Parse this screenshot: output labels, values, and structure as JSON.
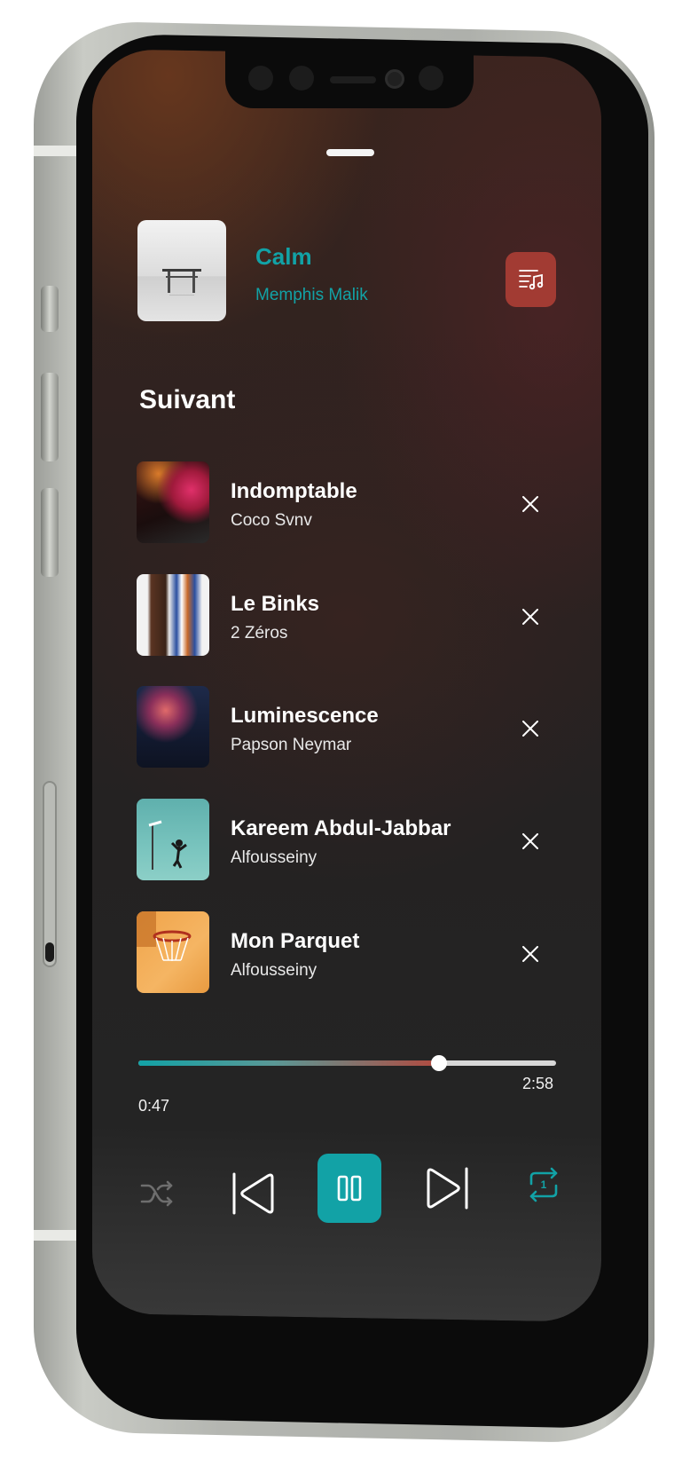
{
  "now_playing": {
    "title": "Calm",
    "artist": "Memphis Malik",
    "lyrics_icon": "music-list-icon"
  },
  "queue": {
    "heading": "Suivant",
    "items": [
      {
        "title": "Indomptable",
        "artist": "Coco Svnv"
      },
      {
        "title": "Le Binks",
        "artist": "2 Zéros"
      },
      {
        "title": "Luminescence",
        "artist": "Papson Neymar"
      },
      {
        "title": "Kareem Abdul-Jabbar",
        "artist": "Alfousseiny"
      },
      {
        "title": "Mon Parquet",
        "artist": "Alfousseiny"
      }
    ],
    "remove_icon": "close-icon"
  },
  "player": {
    "current_time": "0:47",
    "total_time": "2:58",
    "progress": 0.72,
    "controls": {
      "shuffle": "shuffle-icon",
      "previous": "skip-previous-icon",
      "play_pause": "pause-icon",
      "next": "skip-next-icon",
      "repeat": "repeat-one-icon"
    }
  },
  "colors": {
    "accent": "#12a2a6",
    "lyrics_button": "#a23b33",
    "text": "#ffffff"
  }
}
